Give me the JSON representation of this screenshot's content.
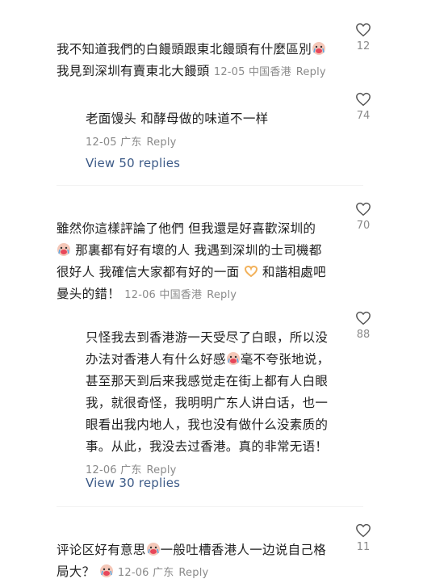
{
  "comments": [
    {
      "lines": [
        "我不知道我們的白饅頭跟東北饅頭有什麼區別",
        "我見到深圳有賣東北大饅頭"
      ],
      "date": "12-05",
      "location": "中国香港",
      "reply_label": "Reply",
      "likes": "12"
    },
    {
      "lines": [
        "老面馒头 和酵母做的味道不一样"
      ],
      "date": "12-05",
      "location": "广东",
      "reply_label": "Reply",
      "likes": "74",
      "view_replies": "View 50 replies"
    },
    {
      "lines": [
        "雖然你這樣評論了他們 但我還是好喜歡深圳的",
        "那裏都有好有壞的人 我遇到深圳的士司機都",
        "很好人 我確信大家都有好的一面",
        "和諧相處吧",
        "曼头的錯！"
      ],
      "date": "12-06",
      "location": "中国香港",
      "reply_label": "Reply",
      "likes": "70"
    },
    {
      "lines": [
        "只怪我去到香港游一天受尽了白眼，所以没",
        "办法对香港人有什么好感",
        "毫不夸张地说，",
        "甚至那天到后来我感觉走在街上都有人白眼",
        "我，就很奇怪，我明明广东人讲白话，也一",
        "眼看出我内地人，我也没有做什么没素质的",
        "事。从此，我没去过香港。真的非常无语！"
      ],
      "date": "12-06",
      "location": "广东",
      "reply_label": "Reply",
      "likes": "88",
      "view_replies": "View 30 replies"
    },
    {
      "lines": [
        "评论区好有意思",
        "一般吐槽香港人一边说自己格",
        "局大？"
      ],
      "date": "12-06",
      "location": "广东",
      "reply_label": "Reply",
      "likes": "11"
    }
  ],
  "icons": {
    "like": "heart-outline-icon",
    "crying_face": "crying-face-emoji",
    "heart_hands": "heart-hands-emoji"
  }
}
